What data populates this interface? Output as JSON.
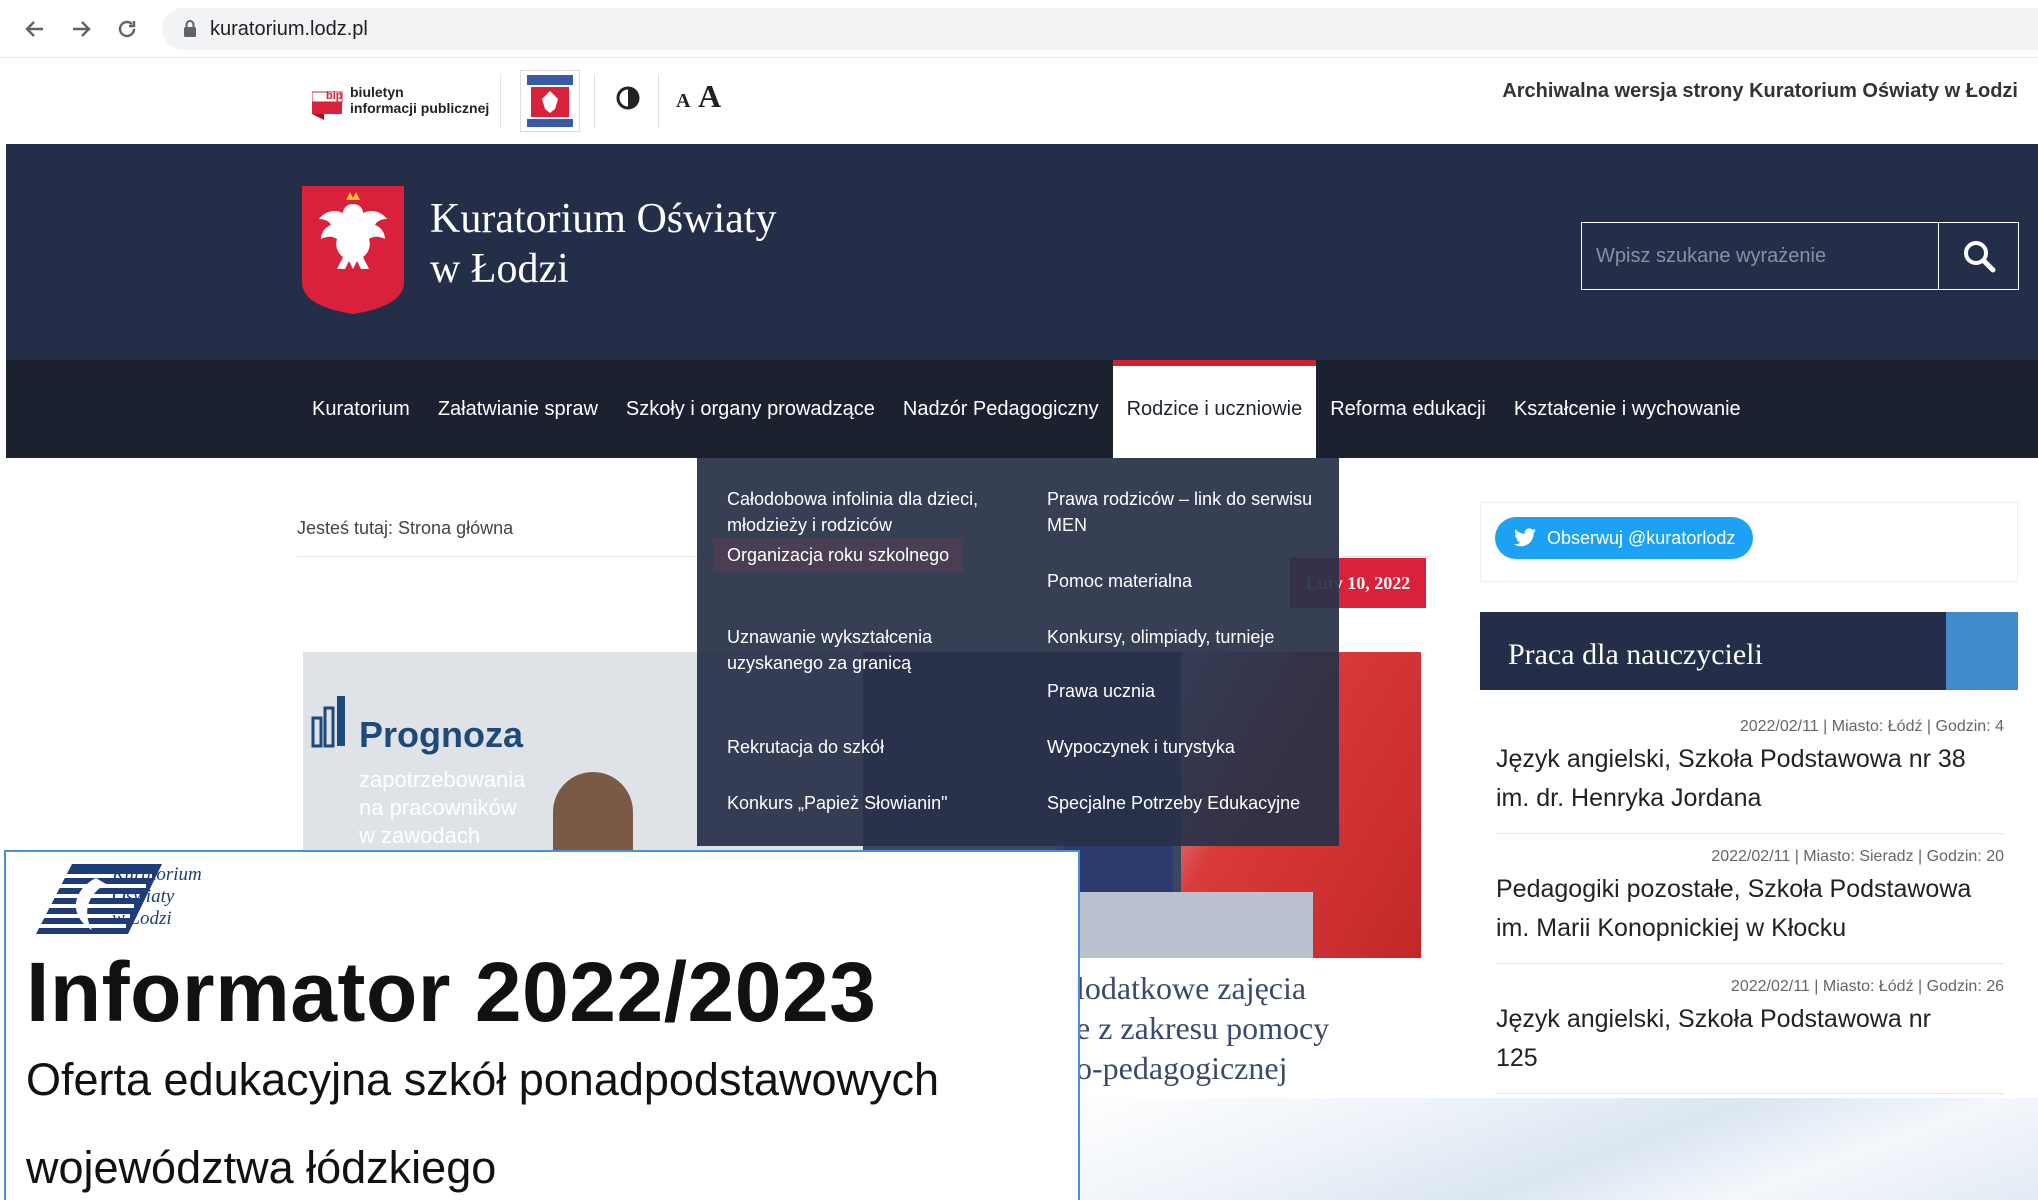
{
  "browser": {
    "url": "kuratorium.lodz.pl"
  },
  "utility": {
    "bip_line1": "biuletyn",
    "bip_line2": "informacji publicznej",
    "bip_badge": "bip",
    "font_small": "A",
    "font_big": "A",
    "archive_text": "Archiwalna wersja strony Kuratorium Oświaty w Łodzi"
  },
  "header": {
    "title_line1": "Kuratorium Oświaty",
    "title_line2": "w Łodzi",
    "search_placeholder": "Wpisz szukane wyrażenie"
  },
  "nav": {
    "items": [
      {
        "label": "Kuratorium"
      },
      {
        "label": "Załatwianie spraw"
      },
      {
        "label": "Szkoły i organy prowadzące"
      },
      {
        "label": "Nadzór Pedagogiczny"
      },
      {
        "label": "Rodzice i uczniowie",
        "active": true
      },
      {
        "label": "Reforma edukacji"
      },
      {
        "label": "Kształcenie i wychowanie"
      }
    ]
  },
  "dropdown": {
    "left": [
      {
        "l1": "Całodobowa infolinia dla dzieci,",
        "l2": "młodzieży i rodziców"
      },
      {
        "l1": "Organizacja roku szkolnego",
        "l2": ""
      },
      {
        "l1": "Uznawanie wykształcenia",
        "l2": "uzyskanego za granicą"
      },
      {
        "l1": "Rekrutacja do szkół",
        "l2": ""
      },
      {
        "l1": "Konkurs „Papież Słowianin\"",
        "l2": ""
      }
    ],
    "right": [
      {
        "l1": "Prawa rodziców – link do serwisu",
        "l2": "MEN"
      },
      {
        "l1": "Pomoc materialna",
        "l2": ""
      },
      {
        "l1": "Konkursy, olimpiady, turnieje",
        "l2": ""
      },
      {
        "l1": "Prawa ucznia",
        "l2": ""
      },
      {
        "l1": "Wypoczynek i turystyka",
        "l2": ""
      },
      {
        "l1": "Specjalne Potrzeby Edukacyjne",
        "l2": ""
      }
    ]
  },
  "content": {
    "breadcrumb": "Jesteś tutaj: Strona główna",
    "date_badge": "Luty 10, 2022",
    "slide_title": "Prognoza",
    "slide_sub1": "zapotrzebowania",
    "slide_sub2": "na pracowników",
    "slide_sub3": "w zawodach",
    "article_line1": "lodatkowe zajęcia",
    "article_line2": "e z zakresu pomocy",
    "article_line3": "o-pedagogicznej"
  },
  "sidebar": {
    "twitter_label": "Obserwuj @kuratorlodz",
    "jobs_title": "Praca dla nauczycieli",
    "jobs": [
      {
        "meta": "2022/02/11 | Miasto: Łódź | Godzin: 4",
        "title_l1": "Język angielski, Szkoła Podstawowa nr 38",
        "title_l2": "im. dr. Henryka Jordana"
      },
      {
        "meta": "2022/02/11 | Miasto: Sieradz | Godzin: 20",
        "title_l1": "Pedagogiki pozostałe, Szkoła Podstawowa",
        "title_l2": "im. Marii Konopnickiej w Kłocku"
      },
      {
        "meta": "2022/02/11 | Miasto: Łódź | Godzin: 26",
        "title_l1": "Język angielski, Szkoła Podstawowa nr",
        "title_l2": "125"
      }
    ]
  },
  "informator": {
    "logo_l1": "Kuratorium",
    "logo_l2": "Oświaty",
    "logo_l3": "w Łodzi",
    "title": "Informator 2022/2023",
    "sub_line1": "Oferta edukacyjna szkół ponadpodstawowych",
    "sub_line2": "województwa łódzkiego"
  },
  "colors": {
    "header_bg": "#252e48",
    "nav_bg": "#1c2130",
    "accent_red": "#d9213b",
    "twitter_blue": "#1da1f2",
    "jobs_accent": "#3f8bcb"
  }
}
